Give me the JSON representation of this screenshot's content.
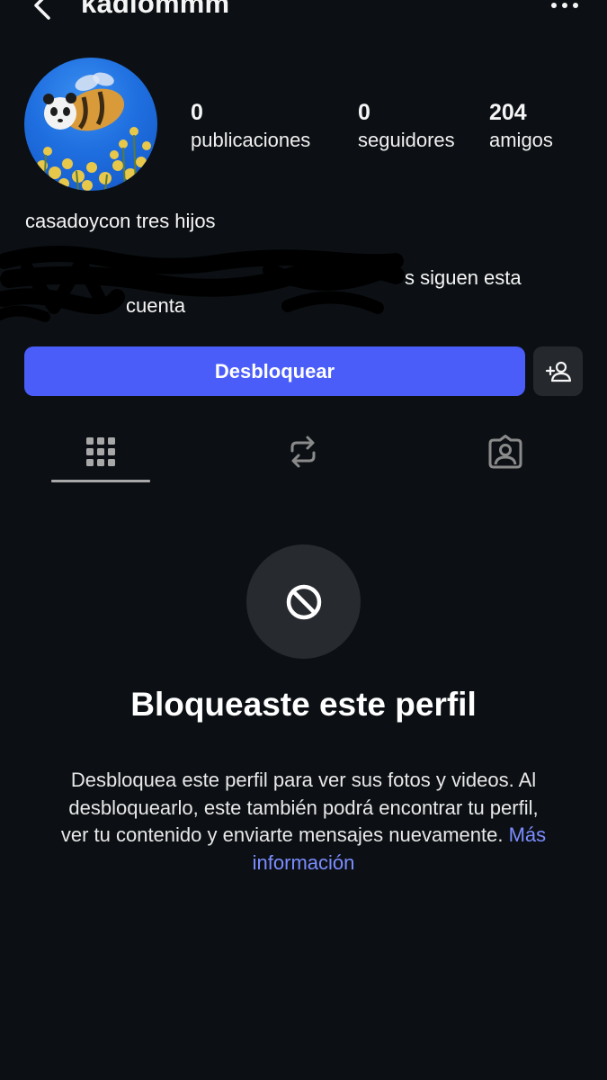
{
  "header": {
    "username": "kadlommm"
  },
  "profile": {
    "stats": [
      {
        "value": "0",
        "label": "publicaciones"
      },
      {
        "value": "0",
        "label": "seguidores"
      },
      {
        "value": "204",
        "label": "amigos"
      }
    ],
    "bio": "casadoycon tres hijos",
    "mutuals_line1": "s siguen esta",
    "mutuals_line2": "cuenta"
  },
  "actions": {
    "unblock_label": "Desbloquear"
  },
  "blocked": {
    "title": "Bloqueaste este perfil",
    "description": "Desbloquea este perfil para ver sus fotos y videos. Al desbloquearlo, este también podrá encontrar tu perfil, ver tu contenido y enviarte mensajes nuevamente.",
    "more_info": "Más información"
  },
  "colors": {
    "background": "#0c1014",
    "accent": "#4a5df9",
    "link": "#7b8dff",
    "secondary_button": "#25292e"
  }
}
